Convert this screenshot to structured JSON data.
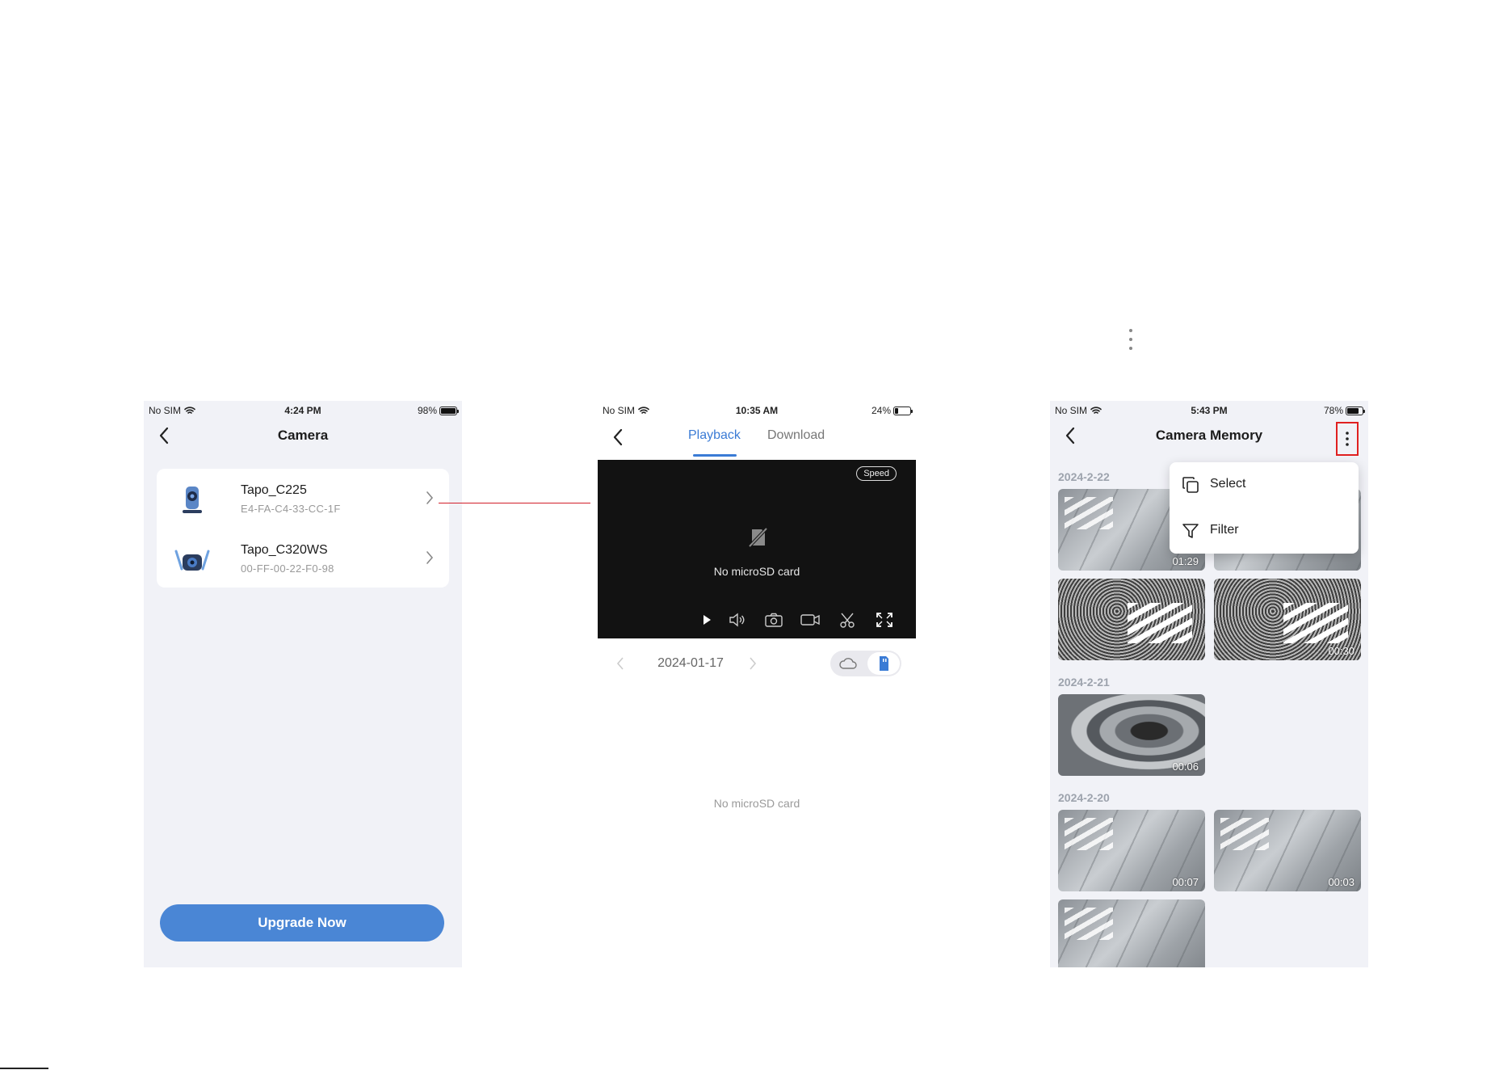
{
  "screens": {
    "camera": {
      "status": {
        "carrier": "No SIM",
        "time": "4:24 PM",
        "battery": "98%",
        "battery_level": 0.98
      },
      "title": "Camera",
      "devices": [
        {
          "name": "Tapo_C225",
          "mac": "E4-FA-C4-33-CC-1F",
          "icon": "camera-c225-icon"
        },
        {
          "name": "Tapo_C320WS",
          "mac": "00-FF-00-22-F0-98",
          "icon": "camera-c320ws-icon"
        }
      ],
      "upgrade_label": "Upgrade Now"
    },
    "playback": {
      "status": {
        "carrier": "No SIM",
        "time": "10:35 AM",
        "battery": "24%",
        "battery_level": 0.24
      },
      "tabs": [
        {
          "label": "Playback",
          "active": true
        },
        {
          "label": "Download",
          "active": false
        }
      ],
      "speed_label": "Speed",
      "player_message": "No microSD card",
      "controls": [
        "play-icon",
        "speaker-icon",
        "camera-snapshot-icon",
        "record-icon",
        "scissors-icon",
        "fullscreen-icon"
      ],
      "date": "2024-01-17",
      "storage_toggle": [
        "cloud-icon",
        "sd-card-icon"
      ],
      "empty_message": "No microSD card"
    },
    "memory": {
      "status": {
        "carrier": "No SIM",
        "time": "5:43 PM",
        "battery": "78%",
        "battery_level": 0.78
      },
      "title": "Camera Memory",
      "menu": [
        {
          "label": "Select",
          "icon": "copy-select-icon"
        },
        {
          "label": "Filter",
          "icon": "filter-icon"
        }
      ],
      "groups": [
        {
          "date": "2024-2-22",
          "clips": [
            "01:29",
            "",
            "",
            "00:30"
          ]
        },
        {
          "date": "2024-2-21",
          "clips": [
            "00:06"
          ]
        },
        {
          "date": "2024-2-20",
          "clips": [
            "00:07",
            "00:03",
            ""
          ]
        }
      ]
    }
  },
  "colors": {
    "accent": "#3a7bd5",
    "button": "#4a86d5",
    "highlight": "#e02020",
    "connector": "#d21f2a",
    "screen_bg": "#f1f2f7"
  }
}
